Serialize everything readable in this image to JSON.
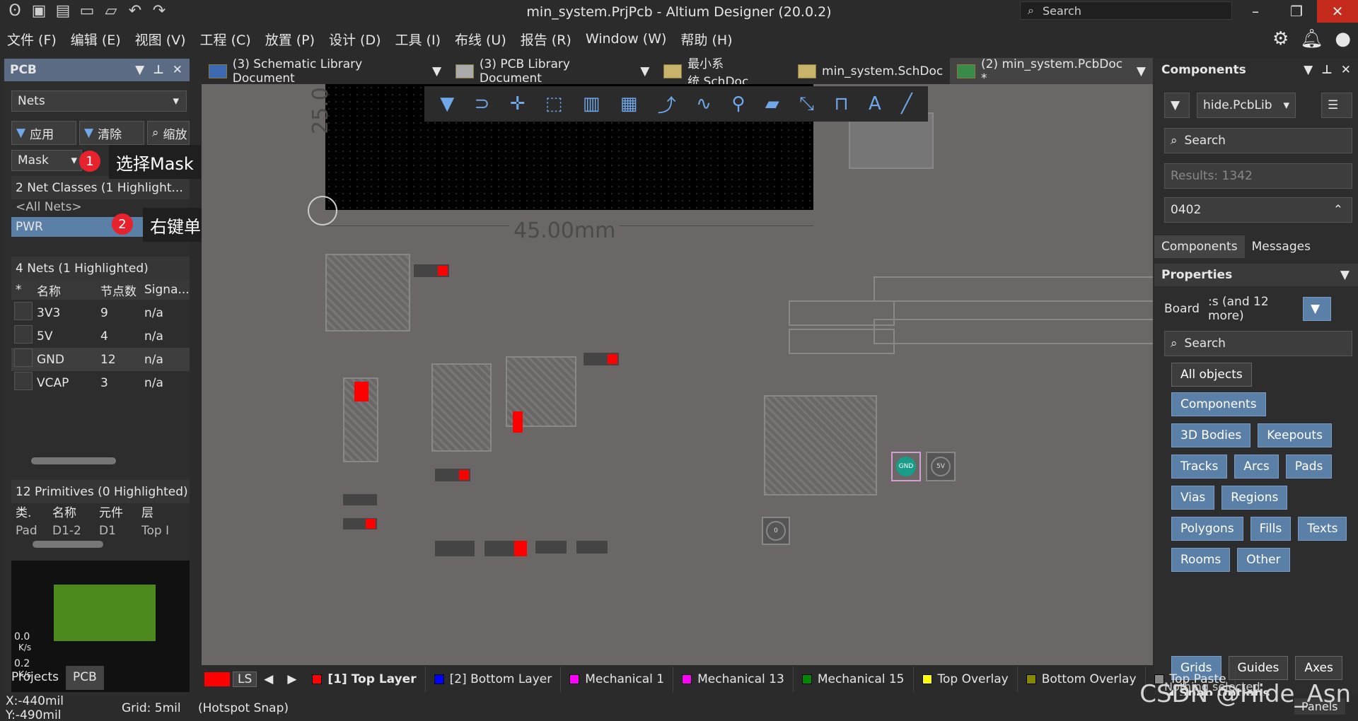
{
  "app": {
    "title": "min_system.PrjPcb - Altium Designer (20.0.2)",
    "search": "Search"
  },
  "menu": [
    "文件 (F)",
    "编辑 (E)",
    "视图 (V)",
    "工程 (C)",
    "放置 (P)",
    "设计 (D)",
    "工具 (I)",
    "布线 (U)",
    "报告 (R)",
    "Window (W)",
    "帮助 (H)"
  ],
  "left": {
    "panel_title": "PCB",
    "mode": "Nets",
    "apply": "应用",
    "clear": "清除",
    "zoom": "缩放",
    "mask": "Mask",
    "classes_header": "2 Net Classes (1 Highlight...",
    "all_nets": "<All Nets>",
    "pwr": "PWR",
    "nets_header": "4 Nets (1 Highlighted)",
    "col_star": "*",
    "col_name": "名称",
    "col_nodes": "节点数",
    "col_signal": "Signa...",
    "nets": [
      {
        "name": "3V3",
        "nodes": "9",
        "sig": "n/a"
      },
      {
        "name": "5V",
        "nodes": "4",
        "sig": "n/a"
      },
      {
        "name": "GND",
        "nodes": "12",
        "sig": "n/a"
      },
      {
        "name": "VCAP",
        "nodes": "3",
        "sig": "n/a"
      }
    ],
    "prims_header": "12 Primitives (0 Highlighted)",
    "p_col1": "类.",
    "p_col2": "名称",
    "p_col3": "元件",
    "p_col4": "层",
    "prim_row": {
      "type": "Pad",
      "name": "D1-2",
      "comp": "D1",
      "layer": "Top I"
    },
    "speed1": "0.0",
    "unit1": "K/s",
    "speed2": "0.2",
    "unit2": "K/s",
    "tab_projects": "Projects",
    "tab_pcb": "PCB"
  },
  "callouts": {
    "c1_num": "1",
    "c1_text": "选择Mask",
    "c2_num": "2",
    "c2_text": "右键单击，选择隐藏飞线"
  },
  "tabs": [
    "(3) Schematic Library Document",
    "(3) PCB Library Document",
    "最小系统.SchDoc",
    "min_system.SchDoc",
    "(2) min_system.PcbDoc *"
  ],
  "canvas": {
    "dimension": "45.00mm",
    "dim_vert": "25.0",
    "gnd": "GND",
    "v5": "5V",
    "zero": "0"
  },
  "right": {
    "components_title": "Components",
    "lib": "hide.PcbLib",
    "search": "Search",
    "results": "Results: 1342",
    "filter": "0402",
    "tab_components": "Components",
    "tab_messages": "Messages",
    "properties": "Properties",
    "board": "Board",
    "board_more": ":s (and 12 more)",
    "search2": "Search",
    "all_objects": "All objects",
    "objects": [
      "Components",
      "3D Bodies",
      "Keepouts",
      "Tracks",
      "Arcs",
      "Pads",
      "Vias",
      "Regions",
      "Polygons",
      "Fills",
      "Texts",
      "Rooms",
      "Other"
    ],
    "snap": "Snap Options",
    "grids": "Grids",
    "guides": "Guides",
    "axes": "Axes",
    "nothing": "Nothing selected",
    "panels": "Panels"
  },
  "layers": [
    {
      "name": "[1] Top Layer",
      "color": "#ff0000"
    },
    {
      "name": "[2] Bottom Layer",
      "color": "#0000ff"
    },
    {
      "name": "Mechanical 1",
      "color": "#ff00ff"
    },
    {
      "name": "Mechanical 13",
      "color": "#ff00ff"
    },
    {
      "name": "Mechanical 15",
      "color": "#008000"
    },
    {
      "name": "Top Overlay",
      "color": "#ffff00"
    },
    {
      "name": "Bottom Overlay",
      "color": "#808000"
    },
    {
      "name": "Top Paste",
      "color": "#808080"
    }
  ],
  "ls": "LS",
  "status": {
    "coords": "X:-440mil Y:-490mil",
    "grid": "Grid: 5mil",
    "snap": "(Hotspot Snap)"
  },
  "watermark": "CSDN @Hide_Asn"
}
